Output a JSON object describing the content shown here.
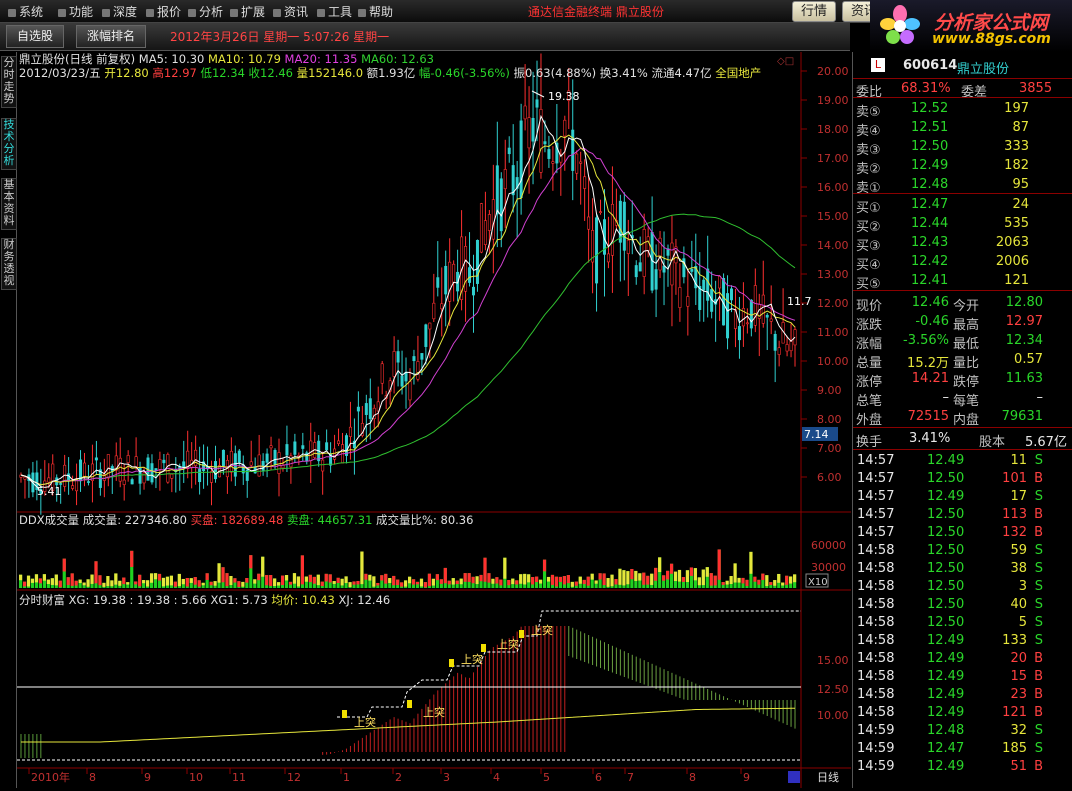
{
  "menu": [
    "系统",
    "功能",
    "深度",
    "报价",
    "分析",
    "扩展",
    "资讯",
    "工具",
    "帮助"
  ],
  "app_title": "通达信金融终端 鼎立股份",
  "top_tabs": [
    "行情",
    "资讯"
  ],
  "logo": {
    "main": "分析家公式网",
    "sub": "www.88gs.com"
  },
  "toolbar": {
    "btn1": "自选股",
    "btn2": "涨幅排名",
    "date": "2012年3月26日  星期一   5:07:26  星期一"
  },
  "side_tabs": [
    {
      "label": "分时走势",
      "active": false
    },
    {
      "label": "技术分析",
      "active": true
    },
    {
      "label": "基本资料",
      "active": false
    },
    {
      "label": "财务透视",
      "active": false
    }
  ],
  "main_chart": {
    "title_parts": [
      {
        "text": "鼎立股份(日线 前复权)",
        "color": "#e0e0e0"
      },
      {
        "text": "MA5: 10.30",
        "color": "#e0e0e0"
      },
      {
        "text": "MA10: 10.79",
        "color": "#e6e63c"
      },
      {
        "text": "MA20: 11.35",
        "color": "#e040e0"
      },
      {
        "text": "MA60: 12.63",
        "color": "#30d030"
      }
    ],
    "info_parts": [
      {
        "text": "2012/03/23/五",
        "color": "#e0e0e0"
      },
      {
        "text": "开12.80",
        "color": "#e6e63c"
      },
      {
        "text": "高12.97",
        "color": "#ff4040"
      },
      {
        "text": "低12.34",
        "color": "#2ad62a"
      },
      {
        "text": "收12.46",
        "color": "#2ad62a"
      },
      {
        "text": "量152146.0",
        "color": "#e6e63c"
      },
      {
        "text": "额1.93亿",
        "color": "#e0e0e0"
      },
      {
        "text": "幅-0.46(-3.56%)",
        "color": "#2ad62a"
      },
      {
        "text": "振0.63(4.88%)",
        "color": "#e0e0e0"
      },
      {
        "text": "换3.41%",
        "color": "#e0e0e0"
      },
      {
        "text": "流通4.47亿",
        "color": "#e0e0e0"
      },
      {
        "text": "全国地产",
        "color": "#e6e63c"
      }
    ],
    "high_label": "19.38",
    "low_label": "5.41",
    "last_label": "11.7",
    "y_ticks": [
      "20.00",
      "19.00",
      "18.00",
      "17.00",
      "16.00",
      "15.00",
      "14.00",
      "13.00",
      "12.00",
      "11.00",
      "10.00",
      "9.00",
      "8.00",
      "7.00",
      "6.00"
    ],
    "y_marker": "7.14"
  },
  "volume_panel": {
    "parts": [
      {
        "text": "DDX成交量",
        "color": "#e0e0e0"
      },
      {
        "text": "成交量: 227346.80",
        "color": "#e0e0e0"
      },
      {
        "text": "买盘: 182689.48",
        "color": "#ff4040"
      },
      {
        "text": "卖盘: 44657.31",
        "color": "#2ad62a"
      },
      {
        "text": "成交量比%: 80.36",
        "color": "#e0e0e0"
      }
    ],
    "y_ticks": [
      "60000",
      "30000"
    ],
    "unit": "X10"
  },
  "fortune_panel": {
    "parts": [
      {
        "text": "分时财富",
        "color": "#e0e0e0"
      },
      {
        "text": "XG: 19.38 : 19.38",
        "color": "#e0e0e0"
      },
      {
        "text": ": 5.66  XG1: 5.73",
        "color": "#e0e0e0"
      },
      {
        "text": "均价: 10.43",
        "color": "#e6e63c"
      },
      {
        "text": "XJ: 12.46",
        "color": "#e0e0e0"
      }
    ],
    "y_ticks": [
      "15.00",
      "12.50",
      "10.00"
    ],
    "signal_label": "上突"
  },
  "x_axis": {
    "labels": [
      "2010年",
      "8",
      "9",
      "10",
      "11",
      "12",
      "1",
      "2",
      "3",
      "4",
      "5",
      "6",
      "7",
      "8",
      "9"
    ],
    "period": "日线"
  },
  "quote": {
    "code": "600614",
    "name": "鼎立股份",
    "weibi_label": "委比",
    "weibi": "68.31%",
    "weicha_label": "委差",
    "weicha": "3855",
    "asks": [
      {
        "label": "卖⑤",
        "price": "12.52",
        "vol": "197"
      },
      {
        "label": "卖④",
        "price": "12.51",
        "vol": "87"
      },
      {
        "label": "卖③",
        "price": "12.50",
        "vol": "333"
      },
      {
        "label": "卖②",
        "price": "12.49",
        "vol": "182"
      },
      {
        "label": "卖①",
        "price": "12.48",
        "vol": "95"
      }
    ],
    "bids": [
      {
        "label": "买①",
        "price": "12.47",
        "vol": "24"
      },
      {
        "label": "买②",
        "price": "12.44",
        "vol": "535"
      },
      {
        "label": "买③",
        "price": "12.43",
        "vol": "2063"
      },
      {
        "label": "买④",
        "price": "12.42",
        "vol": "2006"
      },
      {
        "label": "买⑤",
        "price": "12.41",
        "vol": "121"
      }
    ],
    "stats": [
      {
        "l1": "现价",
        "v1": "12.46",
        "c1": "green",
        "l2": "今开",
        "v2": "12.80",
        "c2": "green"
      },
      {
        "l1": "涨跌",
        "v1": "-0.46",
        "c1": "green",
        "l2": "最高",
        "v2": "12.97",
        "c2": "red"
      },
      {
        "l1": "涨幅",
        "v1": "-3.56%",
        "c1": "green",
        "l2": "最低",
        "v2": "12.34",
        "c2": "green"
      },
      {
        "l1": "总量",
        "v1": "15.2万",
        "c1": "yellow",
        "l2": "量比",
        "v2": "0.57",
        "c2": "yellow"
      },
      {
        "l1": "涨停",
        "v1": "14.21",
        "c1": "red",
        "l2": "跌停",
        "v2": "11.63",
        "c2": "green"
      },
      {
        "l1": "总笔",
        "v1": "–",
        "c1": "white",
        "l2": "每笔",
        "v2": "–",
        "c2": "white"
      },
      {
        "l1": "外盘",
        "v1": "72515",
        "c1": "red",
        "l2": "内盘",
        "v2": "79631",
        "c2": "green"
      }
    ],
    "turnover_label": "换手",
    "turnover": "3.41%",
    "share_label": "股本",
    "share": "5.67亿",
    "ticks": [
      {
        "t": "14:57",
        "p": "12.49",
        "v": "11",
        "s": "S"
      },
      {
        "t": "14:57",
        "p": "12.50",
        "v": "101",
        "s": "B"
      },
      {
        "t": "14:57",
        "p": "12.49",
        "v": "17",
        "s": "S"
      },
      {
        "t": "14:57",
        "p": "12.50",
        "v": "113",
        "s": "B"
      },
      {
        "t": "14:57",
        "p": "12.50",
        "v": "132",
        "s": "B"
      },
      {
        "t": "14:58",
        "p": "12.50",
        "v": "59",
        "s": "S"
      },
      {
        "t": "14:58",
        "p": "12.50",
        "v": "38",
        "s": "S"
      },
      {
        "t": "14:58",
        "p": "12.50",
        "v": "3",
        "s": "S"
      },
      {
        "t": "14:58",
        "p": "12.50",
        "v": "40",
        "s": "S"
      },
      {
        "t": "14:58",
        "p": "12.50",
        "v": "5",
        "s": "S"
      },
      {
        "t": "14:58",
        "p": "12.49",
        "v": "133",
        "s": "S"
      },
      {
        "t": "14:58",
        "p": "12.49",
        "v": "20",
        "s": "B"
      },
      {
        "t": "14:58",
        "p": "12.49",
        "v": "15",
        "s": "B"
      },
      {
        "t": "14:58",
        "p": "12.49",
        "v": "23",
        "s": "B"
      },
      {
        "t": "14:58",
        "p": "12.49",
        "v": "121",
        "s": "B"
      },
      {
        "t": "14:59",
        "p": "12.48",
        "v": "32",
        "s": "S"
      },
      {
        "t": "14:59",
        "p": "12.47",
        "v": "185",
        "s": "S"
      },
      {
        "t": "14:59",
        "p": "12.49",
        "v": "51",
        "s": "B"
      }
    ]
  }
}
